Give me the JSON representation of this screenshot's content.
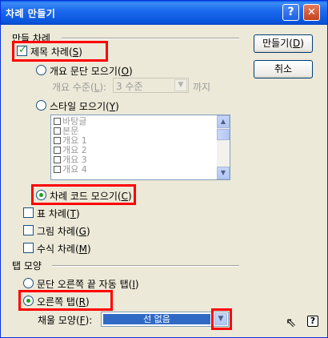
{
  "window": {
    "title": "차례 만들기",
    "help_glyph": "?",
    "close_glyph": "✕"
  },
  "make_group": {
    "label": "만들 차례",
    "heading_toc": {
      "label": "제목 차례(",
      "mnemonic": "S",
      "tail": ")",
      "checked": true
    },
    "gather_outline": {
      "label": "개요 문단 모으기(",
      "mnemonic": "O",
      "tail": ")",
      "selected": false
    },
    "outline_level": {
      "label": "개요 수준(",
      "mnemonic": "L",
      "tail": "):",
      "value": "3 수준",
      "suffix": "까지"
    },
    "gather_style": {
      "label": "스타일 모으기(",
      "mnemonic": "Y",
      "tail": ")",
      "selected": false
    },
    "style_list": [
      "바탕글",
      "본문",
      "개요 1",
      "개요 2",
      "개요 3",
      "개요 4"
    ],
    "gather_code": {
      "label": "차례 코드 모으기(",
      "mnemonic": "C",
      "tail": ")",
      "selected": true
    },
    "table_toc": {
      "label": "표 차례(",
      "mnemonic": "T",
      "tail": ")",
      "checked": false
    },
    "figure_toc": {
      "label": "그림 차례(",
      "mnemonic": "G",
      "tail": ")",
      "checked": false
    },
    "equation_toc": {
      "label": "수식 차례(",
      "mnemonic": "M",
      "tail": ")",
      "checked": false
    }
  },
  "buttons": {
    "make": {
      "label": "만들기(",
      "mnemonic": "D",
      "tail": ")"
    },
    "cancel": {
      "label": "취소"
    }
  },
  "tab_group": {
    "label": "탭 모양",
    "auto_tab": {
      "label": "문단 오른쪽 끝 자동 탭(",
      "mnemonic": "I",
      "tail": ")",
      "selected": false
    },
    "right_tab": {
      "label": "오른쪽 탭(",
      "mnemonic": "R",
      "tail": ")",
      "selected": true
    },
    "fill": {
      "label": "채울 모양(",
      "mnemonic": "F",
      "tail": "):",
      "value": "선 없음"
    }
  },
  "icons": {
    "list_up": "▲",
    "list_down": "▼",
    "select_down": "▼",
    "cursor": "⇖",
    "help_q": "?"
  },
  "colors": {
    "highlight": "#ff0000",
    "titlebar": "#0a5fe8",
    "selection": "#316ac5",
    "check": "#21a121"
  }
}
